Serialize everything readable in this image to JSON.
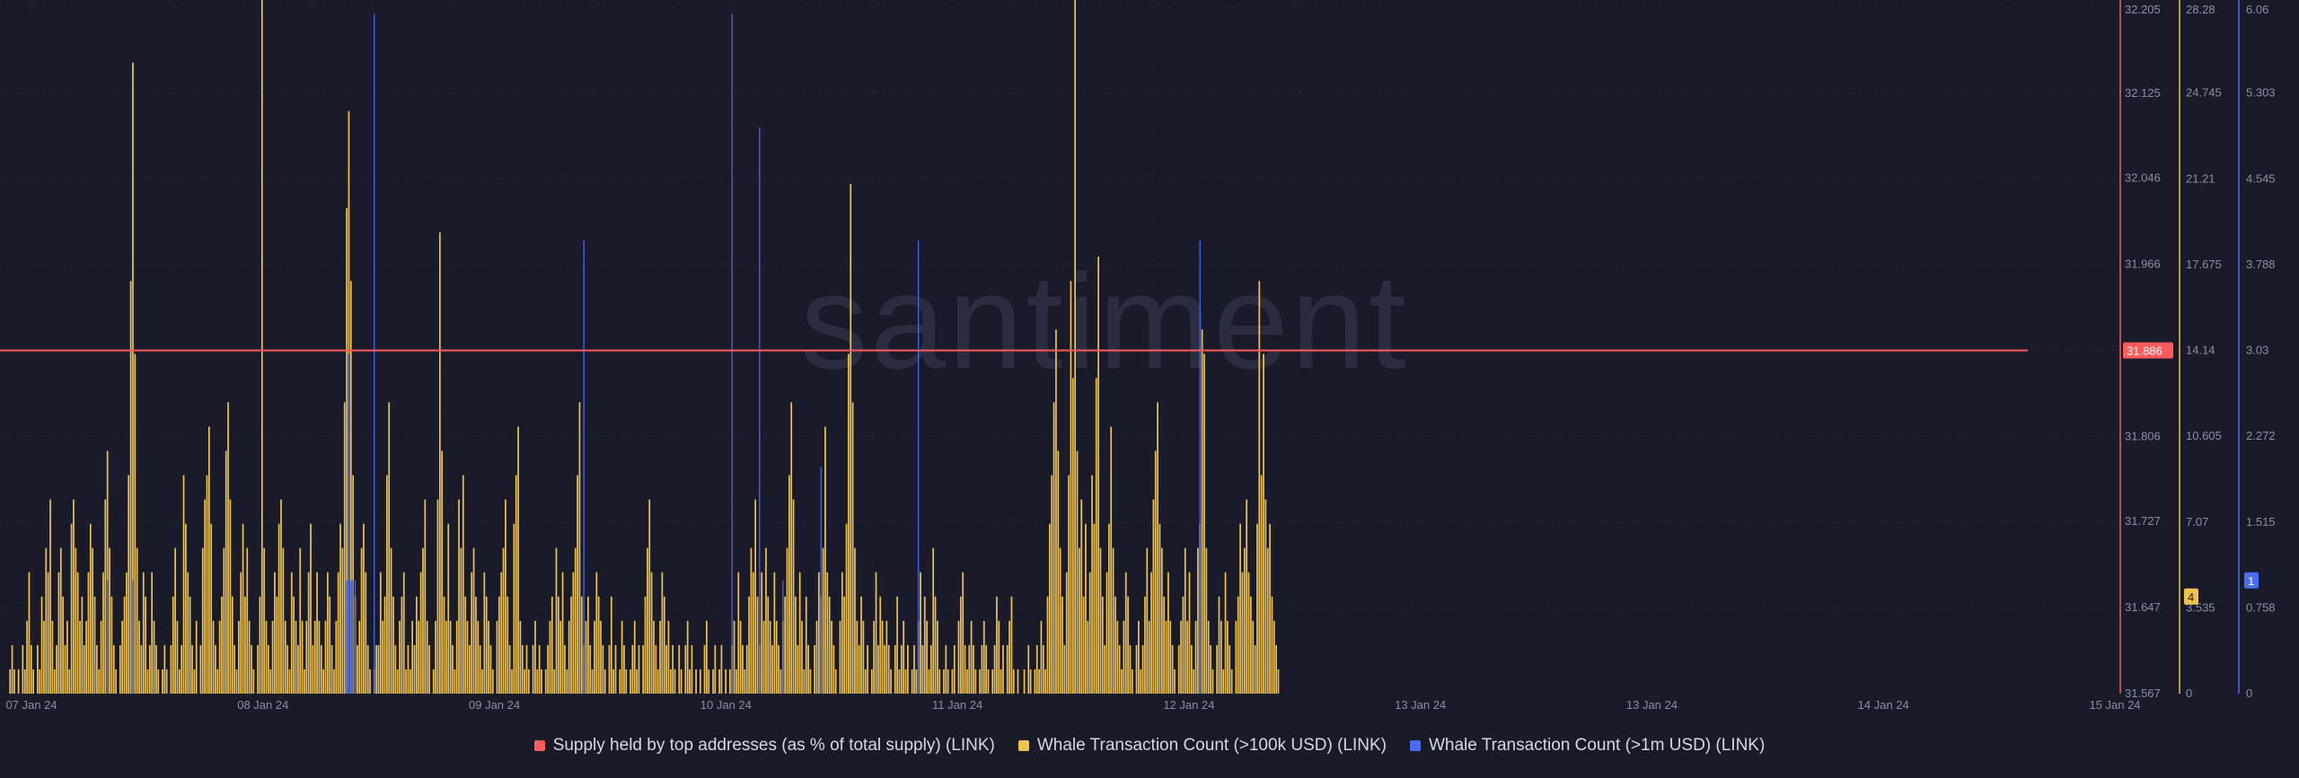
{
  "chart_data": {
    "type": "bar",
    "watermark": "santiment",
    "x_ticks": [
      "07 Jan 24",
      "08 Jan 24",
      "09 Jan 24",
      "10 Jan 24",
      "11 Jan 24",
      "12 Jan 24",
      "13 Jan 24",
      "13 Jan 24",
      "14 Jan 24",
      "15 Jan 24"
    ],
    "axes": {
      "supply": {
        "ticks": [
          "32.205",
          "32.125",
          "32.046",
          "31.966",
          "31.806",
          "31.727",
          "31.647",
          "31.567"
        ],
        "range": [
          31.567,
          32.205
        ],
        "current": "31.886",
        "color": "#ff5b5b"
      },
      "count_100k": {
        "ticks": [
          "28.28",
          "24.745",
          "21.21",
          "17.675",
          "14.14",
          "10.605",
          "7.07",
          "3.535",
          "0"
        ],
        "range": [
          0,
          28.28
        ],
        "current": "4",
        "color": "#f0c44c"
      },
      "count_1m": {
        "ticks": [
          "6.06",
          "5.303",
          "4.545",
          "3.788",
          "3.03",
          "2.272",
          "1.515",
          "0.758",
          "0"
        ],
        "range": [
          0,
          6.06
        ],
        "current": "1",
        "color": "#4a6cf7"
      }
    },
    "series": [
      {
        "name": "Supply held by top addresses (as % of total supply) (LINK)",
        "color": "#ff5b5b",
        "type": "line",
        "values": [
          31.886,
          31.886
        ]
      },
      {
        "name": "Whale Transaction Count (>100k USD) (LINK)",
        "color": "#f0c44c",
        "type": "bar",
        "values": [
          0,
          1,
          2,
          1,
          0,
          1,
          0,
          2,
          1,
          3,
          5,
          2,
          1,
          0,
          2,
          1,
          4,
          3,
          6,
          5,
          8,
          3,
          1,
          2,
          5,
          6,
          4,
          2,
          3,
          1,
          7,
          8,
          6,
          5,
          3,
          4,
          2,
          3,
          5,
          7,
          6,
          4,
          2,
          1,
          3,
          5,
          8,
          10,
          6,
          4,
          2,
          1,
          0,
          2,
          3,
          4,
          5,
          9,
          17,
          26,
          14,
          6,
          3,
          2,
          5,
          4,
          1,
          2,
          5,
          3,
          2,
          1,
          0,
          1,
          2,
          1,
          0,
          2,
          4,
          6,
          3,
          1,
          2,
          9,
          7,
          5,
          4,
          2,
          1,
          3,
          0,
          2,
          6,
          8,
          9,
          11,
          7,
          3,
          2,
          1,
          3,
          4,
          6,
          10,
          12,
          8,
          4,
          2,
          1,
          3,
          5,
          7,
          4,
          6,
          3,
          2,
          1,
          0,
          2,
          4,
          29,
          6,
          3,
          2,
          1,
          3,
          5,
          4,
          7,
          8,
          6,
          3,
          2,
          1,
          5,
          4,
          3,
          2,
          6,
          3,
          1,
          3,
          5,
          7,
          2,
          3,
          5,
          3,
          2,
          1,
          3,
          5,
          4,
          2,
          1,
          3,
          5,
          7,
          6,
          12,
          20,
          24,
          17,
          9,
          4,
          2,
          3,
          6,
          7,
          5,
          2,
          1,
          0,
          1,
          2,
          2,
          5,
          3,
          4,
          9,
          12,
          6,
          4,
          2,
          1,
          3,
          4,
          5,
          1,
          2,
          1,
          3,
          2,
          4,
          3,
          5,
          6,
          8,
          3,
          2,
          0,
          1,
          3,
          8,
          19,
          10,
          4,
          3,
          7,
          3,
          2,
          1,
          3,
          8,
          6,
          9,
          4,
          3,
          2,
          5,
          6,
          4,
          3,
          2,
          1,
          5,
          4,
          3,
          2,
          1,
          0,
          3,
          4,
          5,
          6,
          8,
          4,
          2,
          1,
          7,
          9,
          11,
          3,
          2,
          1,
          2,
          1,
          0,
          2,
          3,
          1,
          2,
          1,
          0,
          1,
          2,
          3,
          4,
          1,
          6,
          4,
          3,
          5,
          2,
          1,
          3,
          4,
          5,
          6,
          9,
          12,
          4,
          2,
          3,
          4,
          2,
          1,
          3,
          5,
          4,
          3,
          2,
          1,
          0,
          2,
          4,
          1,
          2,
          0,
          1,
          3,
          2,
          1,
          0,
          1,
          2,
          3,
          1,
          2,
          0,
          2,
          4,
          6,
          8,
          5,
          3,
          2,
          1,
          3,
          5,
          4,
          2,
          3,
          1,
          2,
          1,
          0,
          2,
          1,
          0,
          2,
          3,
          1,
          2,
          0,
          1,
          0,
          1,
          0,
          2,
          3,
          1,
          0,
          1,
          2,
          0,
          1,
          2,
          0,
          1,
          0,
          1,
          2,
          3,
          1,
          5,
          3,
          2,
          1,
          2,
          4,
          6,
          5,
          8,
          4,
          2,
          5,
          3,
          6,
          4,
          3,
          2,
          5,
          3,
          2,
          1,
          3,
          4,
          6,
          9,
          12,
          8,
          4,
          2,
          5,
          3,
          1,
          4,
          2,
          1,
          0,
          2,
          3,
          5,
          4,
          6,
          11,
          5,
          4,
          3,
          2,
          1,
          0,
          3,
          5,
          4,
          7,
          14,
          21,
          12,
          6,
          3,
          2,
          4,
          3,
          1,
          2,
          0,
          1,
          3,
          5,
          2,
          4,
          3,
          2,
          3,
          2,
          1,
          0,
          2,
          4,
          1,
          2,
          3,
          1,
          2,
          0,
          1,
          2,
          1,
          3,
          5,
          2,
          4,
          3,
          1,
          2,
          6,
          4,
          3,
          1,
          0,
          1,
          2,
          1,
          0,
          1,
          2,
          0,
          3,
          4,
          5,
          2,
          1,
          2,
          3,
          2,
          1,
          0,
          1,
          2,
          3,
          2,
          1,
          0,
          1,
          2,
          4,
          3,
          1,
          2,
          0,
          2,
          3,
          4,
          1,
          0,
          1,
          0,
          0,
          1,
          0,
          2,
          1,
          0,
          1,
          2,
          1,
          3,
          2,
          1,
          4,
          7,
          9,
          12,
          15,
          10,
          6,
          4,
          2,
          5,
          9,
          17,
          13,
          29,
          10,
          6,
          8,
          4,
          7,
          3,
          5,
          9,
          7,
          13,
          18,
          6,
          4,
          2,
          5,
          7,
          11,
          6,
          4,
          3,
          2,
          1,
          3,
          5,
          4,
          2,
          1,
          0,
          2,
          3,
          1,
          2,
          4,
          6,
          3,
          5,
          8,
          10,
          12,
          7,
          6,
          4,
          3,
          5,
          3,
          2,
          1,
          0,
          2,
          3,
          4,
          6,
          3,
          5,
          2,
          1,
          3,
          6,
          7,
          15,
          14,
          6,
          3,
          2,
          1,
          0,
          2,
          4,
          3,
          1,
          5,
          3,
          2,
          1,
          0,
          3,
          4,
          7,
          5,
          6,
          8,
          5,
          4,
          3,
          2,
          7,
          17,
          9,
          14,
          8,
          6,
          7,
          4,
          3,
          2,
          1
        ]
      },
      {
        "name": "Whale Transaction Count (>1m USD) (LINK)",
        "color": "#4a6cf7",
        "type": "bar",
        "values": [
          0,
          0,
          0,
          0,
          0,
          0,
          0,
          0,
          0,
          0,
          0,
          0,
          0,
          0,
          0,
          0,
          0,
          0,
          0,
          0,
          0,
          0,
          0,
          0,
          0,
          0,
          0,
          0,
          0,
          0,
          0,
          0,
          0,
          0,
          0,
          0,
          0,
          0,
          0,
          0,
          0,
          0,
          0,
          0,
          0,
          0,
          0,
          1,
          0,
          0,
          0,
          0,
          0,
          0,
          0,
          0,
          0,
          0,
          0,
          1,
          0,
          0,
          0,
          0,
          0,
          0,
          0,
          0,
          0,
          0,
          0,
          0,
          0,
          0,
          0,
          0,
          0,
          0,
          0,
          0,
          0,
          0,
          0,
          0,
          0,
          0,
          0,
          0,
          0,
          0,
          0,
          0,
          0,
          0,
          0,
          0,
          0,
          0,
          0,
          0,
          0,
          0,
          0,
          0,
          0,
          0,
          0,
          0,
          0,
          0,
          0,
          0,
          0,
          0,
          0,
          0,
          0,
          0,
          0,
          0,
          0,
          0,
          0,
          0,
          0,
          0,
          0,
          0,
          0,
          0,
          0,
          0,
          0,
          0,
          0,
          0,
          0,
          0,
          0,
          0,
          0,
          0,
          0,
          0,
          0,
          0,
          0,
          0,
          0,
          0,
          0,
          0,
          0,
          0,
          0,
          0,
          0,
          0,
          0,
          0,
          1,
          3,
          1,
          1,
          1,
          0,
          0,
          0,
          0,
          0,
          0,
          0,
          0,
          6,
          0,
          0,
          0,
          0,
          0,
          0,
          0,
          0,
          0,
          0,
          0,
          0,
          0,
          0,
          0,
          0,
          0,
          0,
          0,
          0,
          0,
          0,
          0,
          0,
          0,
          0,
          0,
          0,
          0,
          0,
          0,
          0,
          0,
          0,
          0,
          0,
          0,
          0,
          0,
          0,
          0,
          0,
          0,
          0,
          0,
          0,
          0,
          0,
          0,
          0,
          0,
          0,
          0,
          0,
          0,
          0,
          0,
          0,
          0,
          0,
          0,
          0,
          0,
          0,
          0,
          0,
          0,
          0,
          0,
          0,
          0,
          0,
          0,
          0,
          0,
          0,
          0,
          0,
          0,
          0,
          0,
          0,
          0,
          0,
          0,
          0,
          0,
          0,
          0,
          0,
          0,
          0,
          0,
          0,
          0,
          0,
          0,
          0,
          4,
          0,
          0,
          0,
          0,
          0,
          0,
          0,
          0,
          0,
          0,
          0,
          0,
          0,
          0,
          0,
          0,
          0,
          0,
          0,
          0,
          0,
          0,
          0,
          0,
          0,
          0,
          0,
          0,
          0,
          0,
          0,
          0,
          0,
          0,
          0,
          0,
          0,
          0,
          0,
          0,
          0,
          0,
          0,
          0,
          0,
          0,
          0,
          0,
          0,
          0,
          0,
          0,
          0,
          0,
          0,
          0,
          0,
          0,
          0,
          0,
          0,
          0,
          0,
          0,
          0,
          0,
          0,
          0,
          0,
          6,
          0,
          0,
          0,
          0,
          0,
          0,
          0,
          0,
          0,
          0,
          0,
          0,
          5,
          0,
          0,
          0,
          0,
          0,
          0,
          0,
          0,
          0,
          0,
          1,
          0,
          0,
          0,
          0,
          0,
          0,
          0,
          0,
          0,
          0,
          0,
          0,
          0,
          0,
          0,
          0,
          0,
          2,
          0,
          0,
          0,
          0,
          0,
          0,
          0,
          0,
          0,
          0,
          0,
          0,
          0,
          0,
          0,
          0,
          0,
          0,
          0,
          0,
          0,
          0,
          0,
          0,
          0,
          0,
          0,
          0,
          0,
          0,
          0,
          0,
          0,
          0,
          0,
          0,
          0,
          0,
          0,
          0,
          0,
          0,
          0,
          0,
          0,
          4,
          0,
          0,
          0,
          0,
          0,
          0,
          0,
          0,
          0,
          0,
          0,
          0,
          0,
          0,
          0,
          0,
          0,
          0,
          0,
          0,
          0,
          0,
          0,
          0,
          0,
          0,
          0,
          0,
          0,
          0,
          0,
          0,
          0,
          0,
          0,
          0,
          0,
          0,
          0,
          0,
          0,
          0,
          0,
          0,
          0,
          0,
          0,
          0,
          0,
          0,
          0,
          0,
          0,
          0,
          0,
          0,
          0,
          0,
          0,
          0,
          0,
          0,
          0,
          0,
          0,
          0,
          0,
          0,
          0,
          0,
          0,
          0,
          0,
          0,
          0,
          0,
          0,
          0,
          0,
          0,
          0,
          0,
          0,
          0,
          0,
          0,
          0,
          0,
          0,
          0,
          0,
          0,
          0,
          0,
          0,
          0,
          0,
          0,
          0,
          0,
          0,
          0,
          0,
          0,
          0,
          0,
          0,
          0,
          0,
          0,
          0,
          0,
          0,
          0,
          0,
          0,
          0,
          0,
          0,
          0,
          0,
          0,
          0,
          0,
          0,
          0,
          0,
          0,
          0,
          0,
          0,
          0,
          4,
          0,
          0,
          0,
          0,
          0,
          0,
          0,
          0,
          0,
          0,
          0,
          0,
          0,
          0,
          0,
          0,
          0,
          0,
          0,
          0,
          0,
          0,
          0,
          0,
          0,
          0,
          0,
          0,
          0,
          0,
          0,
          0,
          0,
          0,
          0,
          0,
          0,
          0,
          0,
          0,
          0,
          0,
          0,
          0,
          0,
          0,
          0,
          0,
          0,
          0,
          0,
          0,
          0
        ]
      }
    ]
  }
}
